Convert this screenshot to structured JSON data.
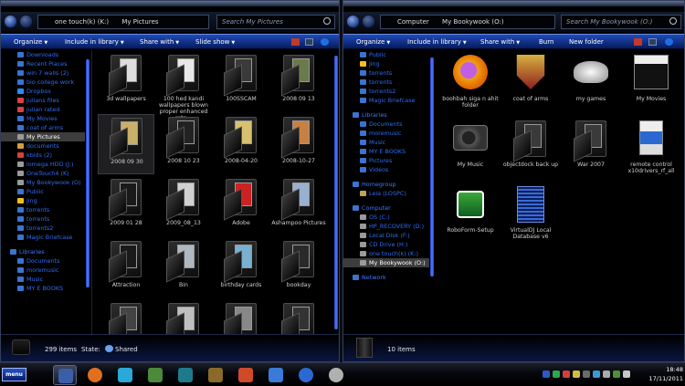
{
  "left": {
    "address": [
      "one touch(k) (K:)",
      "My Pictures"
    ],
    "search_placeholder": "Search My Pictures",
    "toolbar": [
      "Organize",
      "Include in library",
      "Share with",
      "Slide show"
    ],
    "toolbar_dropdown": [
      true,
      true,
      true,
      true
    ],
    "nav": [
      {
        "label": "Downloads",
        "icon": "folder-icon",
        "color": "#3a73d0",
        "indent": 1
      },
      {
        "label": "Recent Places",
        "icon": "folder-icon",
        "color": "#3a73d0",
        "indent": 1
      },
      {
        "label": "win 7 walls (2)",
        "icon": "folder-icon",
        "color": "#3a73d0",
        "indent": 1
      },
      {
        "label": "bio college work",
        "icon": "folder-icon",
        "color": "#3a73d0",
        "indent": 1
      },
      {
        "label": "Dropbox",
        "icon": "dropbox-icon",
        "color": "#2b8cff",
        "indent": 1
      },
      {
        "label": "julians files",
        "icon": "folder-icon",
        "color": "#d94040",
        "indent": 1
      },
      {
        "label": "julian rated",
        "icon": "folder-icon",
        "color": "#d94040",
        "indent": 1
      },
      {
        "label": "My Movies",
        "icon": "folder-icon",
        "color": "#3a73d0",
        "indent": 1
      },
      {
        "label": "coat of arms",
        "icon": "folder-icon",
        "color": "#3a73d0",
        "indent": 1
      },
      {
        "label": "My Pictures",
        "icon": "folder-icon",
        "color": "#9a9a9a",
        "indent": 1,
        "selected": true
      },
      {
        "label": "documents",
        "icon": "folder-icon",
        "color": "#d0a040",
        "indent": 1
      },
      {
        "label": "kbids (2)",
        "icon": "folder-icon",
        "color": "#d94040",
        "indent": 1
      },
      {
        "label": "lomega HDD (J:)",
        "icon": "drive-icon",
        "color": "#9a9a9a",
        "indent": 1
      },
      {
        "label": "OneTouch4 (K)",
        "icon": "drive-icon",
        "color": "#9a9a9a",
        "indent": 1
      },
      {
        "label": "My Bookywook (O)",
        "icon": "drive-icon",
        "color": "#9a9a9a",
        "indent": 1
      },
      {
        "label": "Public",
        "icon": "folder-icon",
        "color": "#3a73d0",
        "indent": 1
      },
      {
        "label": "jing",
        "icon": "jing-icon",
        "color": "#f0c020",
        "indent": 1
      },
      {
        "label": "torrents",
        "icon": "folder-icon",
        "color": "#3a73d0",
        "indent": 1
      },
      {
        "label": "torrents",
        "icon": "folder-icon",
        "color": "#3a73d0",
        "indent": 1
      },
      {
        "label": "torrents2",
        "icon": "folder-icon",
        "color": "#3a73d0",
        "indent": 1
      },
      {
        "label": "Magic Briefcase",
        "icon": "briefcase-icon",
        "color": "#3a73d0",
        "indent": 1
      },
      {
        "label": "Libraries",
        "icon": "library-icon",
        "color": "#3a73d0",
        "indent": 0,
        "group": true,
        "gap": true
      },
      {
        "label": "Documents",
        "icon": "folder-icon",
        "color": "#3a73d0",
        "indent": 1
      },
      {
        "label": "moremusic",
        "icon": "folder-icon",
        "color": "#3a73d0",
        "indent": 1
      },
      {
        "label": "Music",
        "icon": "music-icon",
        "color": "#3a73d0",
        "indent": 1
      },
      {
        "label": "MY E BOOKS",
        "icon": "folder-icon",
        "color": "#3a73d0",
        "indent": 1
      }
    ],
    "items": [
      {
        "label": "3d wallpapers",
        "kind": "folder",
        "paper": "#ddd"
      },
      {
        "label": "100 hed kandi wallpapers blown proper enhanced reto...",
        "kind": "folder",
        "paper": "#e8e8e8"
      },
      {
        "label": "100SSCAM",
        "kind": "folder",
        "paper": "#3a3a3a"
      },
      {
        "label": "2008 09 13",
        "kind": "folder",
        "paper": "#6a7a4a"
      },
      {
        "label": "2008 09 30",
        "kind": "folder",
        "paper": "#c9b06a",
        "selected": true
      },
      {
        "label": "2008 10 23",
        "kind": "folder",
        "paper": "#222"
      },
      {
        "label": "2008-04-20",
        "kind": "folder",
        "paper": "#d8c070"
      },
      {
        "label": "2008-10-27",
        "kind": "folder",
        "paper": "#c88040"
      },
      {
        "label": "2009 01 28",
        "kind": "folder",
        "paper": "#1a1a1a"
      },
      {
        "label": "2009_08_13",
        "kind": "folder",
        "paper": "#d0d0d0"
      },
      {
        "label": "Adobe",
        "kind": "folder",
        "paper": "#cc2222"
      },
      {
        "label": "Ashampoo Pictures",
        "kind": "folder",
        "paper": "#9ab0d0"
      },
      {
        "label": "Attraction",
        "kind": "folder",
        "paper": "#1a1a1a"
      },
      {
        "label": "Bin",
        "kind": "folder",
        "paper": "#b0b8c0"
      },
      {
        "label": "birthday cards",
        "kind": "folder",
        "paper": "#7ab0d0"
      },
      {
        "label": "bookday",
        "kind": "folder",
        "paper": "#2a2a2a"
      },
      {
        "label": "",
        "kind": "folder",
        "paper": "#444"
      },
      {
        "label": "",
        "kind": "folder",
        "paper": "#c0c0c0"
      },
      {
        "label": "",
        "kind": "folder",
        "paper": "#888"
      },
      {
        "label": "",
        "kind": "folder",
        "paper": "#333"
      }
    ],
    "status_count": "299 items",
    "status_state_label": "State:",
    "status_state_value": "Shared"
  },
  "right": {
    "address": [
      "Computer",
      "My Bookywook (O:)"
    ],
    "search_placeholder": "Search My Bookywook (O:)",
    "toolbar": [
      "Organize",
      "Include in library",
      "Share with",
      "Burn",
      "New folder"
    ],
    "toolbar_dropdown": [
      true,
      true,
      true,
      false,
      false
    ],
    "nav": [
      {
        "label": "Public",
        "icon": "folder-icon",
        "color": "#3a73d0",
        "indent": 1
      },
      {
        "label": "jing",
        "icon": "jing-icon",
        "color": "#f0c020",
        "indent": 1
      },
      {
        "label": "torrents",
        "icon": "folder-icon",
        "color": "#3a73d0",
        "indent": 1
      },
      {
        "label": "torrents",
        "icon": "folder-icon",
        "color": "#3a73d0",
        "indent": 1
      },
      {
        "label": "torrents2",
        "icon": "folder-icon",
        "color": "#3a73d0",
        "indent": 1
      },
      {
        "label": "Magic Briefcase",
        "icon": "briefcase-icon",
        "color": "#3a73d0",
        "indent": 1
      },
      {
        "label": "Libraries",
        "icon": "library-icon",
        "color": "#3a73d0",
        "indent": 0,
        "group": true,
        "gap": true
      },
      {
        "label": "Documents",
        "icon": "folder-icon",
        "color": "#3a73d0",
        "indent": 1
      },
      {
        "label": "moremusic",
        "icon": "folder-icon",
        "color": "#3a73d0",
        "indent": 1
      },
      {
        "label": "Music",
        "icon": "music-icon",
        "color": "#3a73d0",
        "indent": 1
      },
      {
        "label": "MY E BOOKS",
        "icon": "folder-icon",
        "color": "#3a73d0",
        "indent": 1
      },
      {
        "label": "Pictures",
        "icon": "folder-icon",
        "color": "#3a73d0",
        "indent": 1
      },
      {
        "label": "Videos",
        "icon": "folder-icon",
        "color": "#3a73d0",
        "indent": 1
      },
      {
        "label": "Homegroup",
        "icon": "homegroup-icon",
        "color": "#3a73d0",
        "indent": 0,
        "group": true,
        "gap": true
      },
      {
        "label": "Leia (LOSPC)",
        "icon": "user-icon",
        "color": "#c0a060",
        "indent": 1
      },
      {
        "label": "Computer",
        "icon": "computer-icon",
        "color": "#3a73d0",
        "indent": 0,
        "group": true,
        "gap": true
      },
      {
        "label": "OS (C:)",
        "icon": "drive-icon",
        "color": "#9a9a9a",
        "indent": 1
      },
      {
        "label": "HP_RECOVERY (D:)",
        "icon": "drive-icon",
        "color": "#9a9a9a",
        "indent": 1
      },
      {
        "label": "Local Disk (F:)",
        "icon": "drive-icon",
        "color": "#9a9a9a",
        "indent": 1
      },
      {
        "label": "CD Drive (H:)",
        "icon": "drive-icon",
        "color": "#9a9a9a",
        "indent": 1
      },
      {
        "label": "one touch(k) (K:)",
        "icon": "drive-icon",
        "color": "#9a9a9a",
        "indent": 1
      },
      {
        "label": "My Bookywook (O:)",
        "icon": "drive-icon",
        "color": "#9a9a9a",
        "indent": 1,
        "selected": true
      },
      {
        "label": "Network",
        "icon": "network-icon",
        "color": "#3a73d0",
        "indent": 0,
        "group": true,
        "gap": true
      }
    ],
    "items": [
      {
        "label": "boohbah siga n ahit folder",
        "kind": "boohbah"
      },
      {
        "label": "coat of arms",
        "kind": "crest"
      },
      {
        "label": "my games",
        "kind": "controller"
      },
      {
        "label": "My Movies",
        "kind": "clapper"
      },
      {
        "label": "My Music",
        "kind": "turntable"
      },
      {
        "label": "objectdock back up",
        "kind": "folder",
        "paper": "#3a3a3a"
      },
      {
        "label": "War 2007",
        "kind": "folder",
        "paper": "#3a3a3a"
      },
      {
        "label": "remote control x10drivers_rf_all",
        "kind": "remote"
      },
      {
        "label": "RoboForm-Setup",
        "kind": "roboform"
      },
      {
        "label": "VirtualDJ Local Database v6",
        "kind": "doc"
      }
    ],
    "status_count": "10 items"
  },
  "taskbar": {
    "start_label": "menu",
    "apps": [
      "windows-explorer",
      "firefox",
      "monitor-app",
      "toolbox-app",
      "network-app",
      "phone-app",
      "dream-app",
      "puzzle-app",
      "maxthon-app",
      "hp-app"
    ],
    "clock_time": "18:48",
    "clock_date": "17/11/2011"
  },
  "colors": {
    "accent": "#1d46c2",
    "link": "#2f6cf0",
    "text": "#d0d0d0"
  }
}
